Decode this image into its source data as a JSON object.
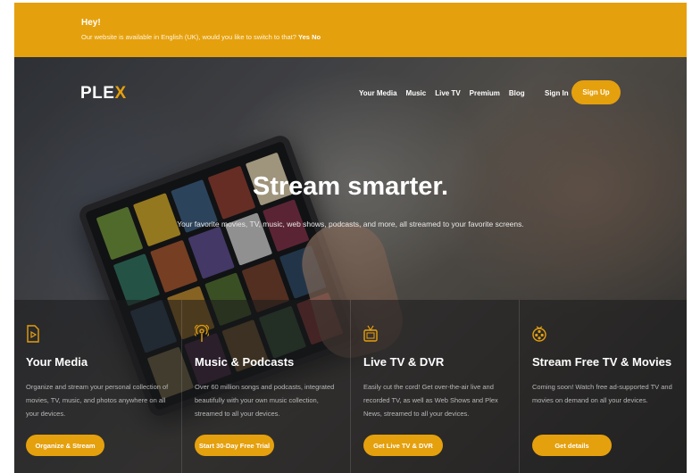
{
  "banner": {
    "title": "Hey!",
    "message": "Our website is available in English (UK), would you like to switch to that?",
    "yes_label": "Yes",
    "no_label": "No"
  },
  "nav": {
    "logo_main": "PLE",
    "logo_x": "X",
    "items": [
      "Your Media",
      "Music",
      "Live TV",
      "Premium",
      "Blog"
    ],
    "sign_in": "Sign In",
    "sign_up": "Sign Up"
  },
  "hero": {
    "headline": "Stream smarter.",
    "subline": "Your favorite movies, TV, music, web shows, podcasts, and more, all streamed to your favorite screens."
  },
  "features": [
    {
      "icon": "media-file-icon",
      "title": "Your Media",
      "description": "Organize and stream your personal collection of movies, TV, music, and photos anywhere on all your devices.",
      "button": "Organize & Stream"
    },
    {
      "icon": "podcast-icon",
      "title": "Music & Podcasts",
      "description": "Over 60 million songs and podcasts, integrated beautifully with your own music collection, streamed to all your devices.",
      "button": "Start 30-Day Free Trial"
    },
    {
      "icon": "tv-icon",
      "title": "Live TV & DVR",
      "description": "Easily cut the cord! Get over-the-air live and recorded TV, as well as Web Shows and Plex News, streamed to all your devices.",
      "button": "Get Live TV & DVR"
    },
    {
      "icon": "film-reel-icon",
      "title": "Stream Free TV & Movies",
      "description": "Coming soon! Watch free ad-supported TV and movies on demand on all your devices.",
      "button": "Get details"
    }
  ],
  "colors": {
    "accent": "#e5a00d",
    "text": "#ffffff"
  }
}
